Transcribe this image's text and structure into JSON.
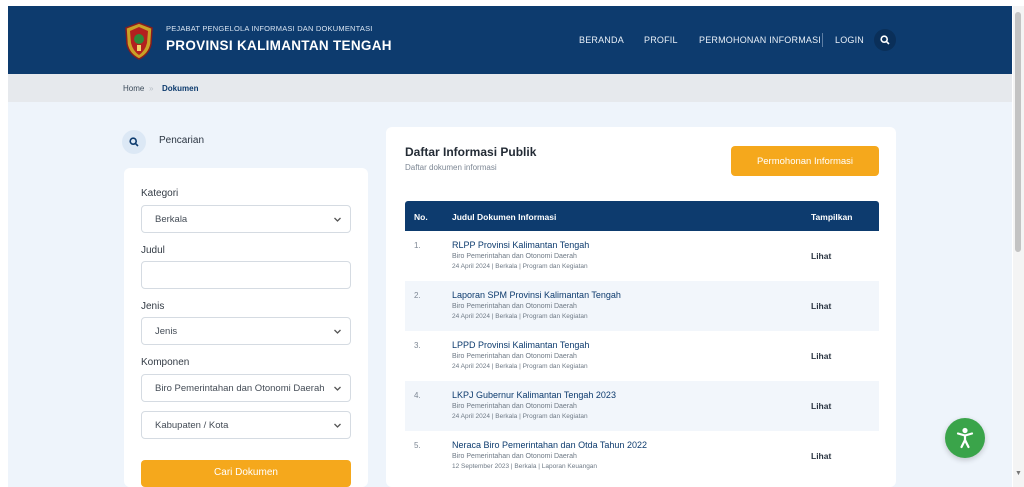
{
  "header": {
    "brand_small": "PEJABAT PENGELOLA INFORMASI DAN DOKUMENTASI",
    "brand_big": "PROVINSI KALIMANTAN TENGAH",
    "nav": {
      "home": "BERANDA",
      "profile": "PROFIL",
      "request": "PERMOHONAN INFORMASI",
      "login": "LOGIN"
    }
  },
  "breadcrumb": {
    "home": "Home",
    "separator": "»",
    "current": "Dokumen"
  },
  "search_panel": {
    "heading": "Pencarian",
    "kategori_label": "Kategori",
    "kategori_value": "Berkala",
    "judul_label": "Judul",
    "judul_value": "",
    "jenis_label": "Jenis",
    "jenis_value": "Jenis",
    "komponen_label": "Komponen",
    "komponen_value": "Biro Pemerintahan dan Otonomi Daerah",
    "kabupaten_value": "Kabupaten / Kota",
    "submit_label": "Cari Dokumen"
  },
  "list": {
    "title": "Daftar Informasi Publik",
    "subtitle": "Daftar dokumen informasi",
    "request_button": "Permohonan Informasi",
    "columns": {
      "no": "No.",
      "title": "Judul Dokumen Informasi",
      "view": "Tampilkan"
    },
    "rows": [
      {
        "no": "1.",
        "title": "RLPP Provinsi Kalimantan Tengah",
        "org": "Biro Pemerintahan dan Otonomi Daerah",
        "meta": "24 April 2024 | Berkala | Program dan Kegiatan",
        "view": "Lihat"
      },
      {
        "no": "2.",
        "title": "Laporan SPM Provinsi Kalimantan Tengah",
        "org": "Biro Pemerintahan dan Otonomi Daerah",
        "meta": "24 April 2024 | Berkala | Program dan Kegiatan",
        "view": "Lihat"
      },
      {
        "no": "3.",
        "title": "LPPD Provinsi Kalimantan Tengah",
        "org": "Biro Pemerintahan dan Otonomi Daerah",
        "meta": "24 April 2024 | Berkala | Program dan Kegiatan",
        "view": "Lihat"
      },
      {
        "no": "4.",
        "title": "LKPJ Gubernur Kalimantan Tengah 2023",
        "org": "Biro Pemerintahan dan Otonomi Daerah",
        "meta": "24 April 2024 | Berkala | Program dan Kegiatan",
        "view": "Lihat"
      },
      {
        "no": "5.",
        "title": "Neraca Biro Pemerintahan dan Otda Tahun 2022",
        "org": "Biro Pemerintahan dan Otonomi Daerah",
        "meta": "12 September 2023 | Berkala | Laporan Keuangan",
        "view": "Lihat"
      }
    ]
  },
  "icons": {
    "logo": "provincial-crest-icon",
    "search": "search-icon",
    "chevron": "chevron-down-icon",
    "accessibility": "accessibility-icon"
  },
  "colors": {
    "primary": "#0d3b6e",
    "accent": "#f5a81c",
    "accessibility": "#3aa44a"
  }
}
